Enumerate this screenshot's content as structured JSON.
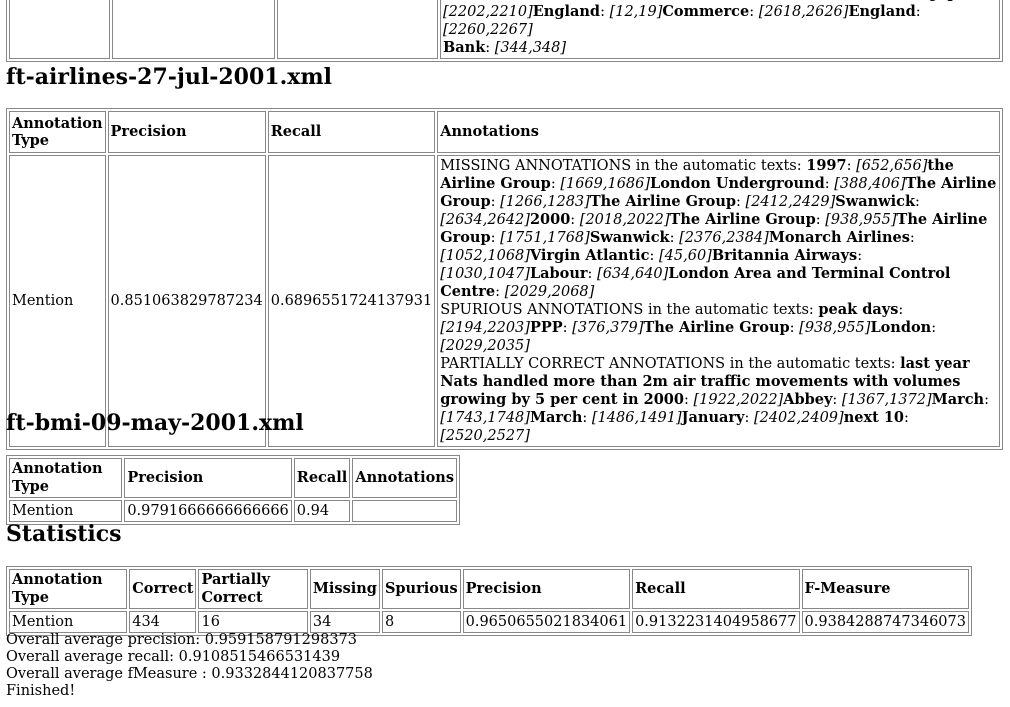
{
  "top_fragment": {
    "line1": [
      {
        "t": "plain",
        "v": "PARTIALLY CORRECT ANNOTATIONS in the automatic texts: "
      },
      {
        "t": "b",
        "v": "US Japan"
      },
      {
        "t": "plain",
        "v": ": "
      }
    ],
    "line2": [
      {
        "t": "i",
        "v": "[2202,2210]"
      },
      {
        "t": "b",
        "v": "England"
      },
      {
        "t": "plain",
        "v": ": "
      },
      {
        "t": "i",
        "v": "[12,19]"
      },
      {
        "t": "b",
        "v": "Commerce"
      },
      {
        "t": "plain",
        "v": ": "
      },
      {
        "t": "i",
        "v": "[2618,2626]"
      },
      {
        "t": "b",
        "v": "England"
      },
      {
        "t": "plain",
        "v": ": "
      },
      {
        "t": "i",
        "v": "[2260,2267]"
      }
    ],
    "line3": [
      {
        "t": "b",
        "v": "Bank"
      },
      {
        "t": "plain",
        "v": ": "
      },
      {
        "t": "i",
        "v": "[344,348]"
      }
    ]
  },
  "section1": {
    "title": "ft-airlines-27-jul-2001.xml",
    "headers": [
      "Annotation Type",
      "Precision",
      "Recall",
      "Annotations"
    ],
    "row": {
      "type": "Mention",
      "precision": "0.851063829787234",
      "recall": "0.6896551724137931",
      "annotations": [
        {
          "t": "plain",
          "v": "MISSING ANNOTATIONS in the automatic texts: "
        },
        {
          "t": "b",
          "v": "1997"
        },
        {
          "t": "plain",
          "v": ": "
        },
        {
          "t": "i",
          "v": "[652,656]"
        },
        {
          "t": "b",
          "v": "the Airline Group"
        },
        {
          "t": "plain",
          "v": ": "
        },
        {
          "t": "i",
          "v": "[1669,1686]"
        },
        {
          "t": "b",
          "v": "London Underground"
        },
        {
          "t": "plain",
          "v": ": "
        },
        {
          "t": "i",
          "v": "[388,406]"
        },
        {
          "t": "b",
          "v": "The Airline Group"
        },
        {
          "t": "plain",
          "v": ": "
        },
        {
          "t": "i",
          "v": "[1266,1283]"
        },
        {
          "t": "b",
          "v": "The Airline Group"
        },
        {
          "t": "plain",
          "v": ": "
        },
        {
          "t": "i",
          "v": "[2412,2429]"
        },
        {
          "t": "b",
          "v": "Swanwick"
        },
        {
          "t": "plain",
          "v": ": "
        },
        {
          "t": "i",
          "v": "[2634,2642]"
        },
        {
          "t": "b",
          "v": "2000"
        },
        {
          "t": "plain",
          "v": ": "
        },
        {
          "t": "i",
          "v": "[2018,2022]"
        },
        {
          "t": "b",
          "v": "The Airline Group"
        },
        {
          "t": "plain",
          "v": ": "
        },
        {
          "t": "i",
          "v": "[938,955]"
        },
        {
          "t": "b",
          "v": "The Airline Group"
        },
        {
          "t": "plain",
          "v": ": "
        },
        {
          "t": "i",
          "v": "[1751,1768]"
        },
        {
          "t": "b",
          "v": "Swanwick"
        },
        {
          "t": "plain",
          "v": ": "
        },
        {
          "t": "i",
          "v": "[2376,2384]"
        },
        {
          "t": "b",
          "v": "Monarch Airlines"
        },
        {
          "t": "plain",
          "v": ": "
        },
        {
          "t": "i",
          "v": "[1052,1068]"
        },
        {
          "t": "b",
          "v": "Virgin Atlantic"
        },
        {
          "t": "plain",
          "v": ": "
        },
        {
          "t": "i",
          "v": "[45,60]"
        },
        {
          "t": "b",
          "v": "Britannia Airways"
        },
        {
          "t": "plain",
          "v": ": "
        },
        {
          "t": "i",
          "v": "[1030,1047]"
        },
        {
          "t": "b",
          "v": "Labour"
        },
        {
          "t": "plain",
          "v": ": "
        },
        {
          "t": "i",
          "v": "[634,640]"
        },
        {
          "t": "b",
          "v": "London Area and Terminal Control Centre"
        },
        {
          "t": "plain",
          "v": ": "
        },
        {
          "t": "i",
          "v": "[2029,2068]"
        },
        {
          "t": "br"
        },
        {
          "t": "plain",
          "v": "SPURIOUS ANNOTATIONS in the automatic texts: "
        },
        {
          "t": "b",
          "v": "peak days"
        },
        {
          "t": "plain",
          "v": ": "
        },
        {
          "t": "i",
          "v": "[2194,2203]"
        },
        {
          "t": "b",
          "v": "PPP"
        },
        {
          "t": "plain",
          "v": ": "
        },
        {
          "t": "i",
          "v": "[376,379]"
        },
        {
          "t": "b",
          "v": "The Airline Group"
        },
        {
          "t": "plain",
          "v": ": "
        },
        {
          "t": "i",
          "v": "[938,955]"
        },
        {
          "t": "b",
          "v": "London"
        },
        {
          "t": "plain",
          "v": ": "
        },
        {
          "t": "i",
          "v": "[2029,2035]"
        },
        {
          "t": "br"
        },
        {
          "t": "plain",
          "v": "PARTIALLY CORRECT ANNOTATIONS in the automatic texts: "
        },
        {
          "t": "b",
          "v": "last year Nats handled more than 2m air traffic movements with volumes growing by 5 per cent in 2000"
        },
        {
          "t": "plain",
          "v": ": "
        },
        {
          "t": "i",
          "v": "[1922,2022]"
        },
        {
          "t": "b",
          "v": "Abbey"
        },
        {
          "t": "plain",
          "v": ": "
        },
        {
          "t": "i",
          "v": "[1367,1372]"
        },
        {
          "t": "b",
          "v": "March"
        },
        {
          "t": "plain",
          "v": ": "
        },
        {
          "t": "i",
          "v": "[1743,1748]"
        },
        {
          "t": "b",
          "v": "March"
        },
        {
          "t": "plain",
          "v": ": "
        },
        {
          "t": "i",
          "v": "[1486,1491]"
        },
        {
          "t": "b",
          "v": "January"
        },
        {
          "t": "plain",
          "v": ": "
        },
        {
          "t": "i",
          "v": "[2402,2409]"
        },
        {
          "t": "b",
          "v": "next 10"
        },
        {
          "t": "plain",
          "v": ": "
        },
        {
          "t": "i",
          "v": "[2520,2527]"
        }
      ]
    }
  },
  "section2": {
    "title": "ft-bmi-09-may-2001.xml",
    "headers": [
      "Annotation Type",
      "Precision",
      "Recall",
      "Annotations"
    ],
    "row": {
      "type": "Mention",
      "precision": "0.9791666666666666",
      "recall": "0.94",
      "annotations": ""
    }
  },
  "statistics": {
    "title": "Statistics",
    "headers": [
      "Annotation Type",
      "Correct",
      "Partially Correct",
      "Missing",
      "Spurious",
      "Precision",
      "Recall",
      "F-Measure"
    ],
    "row": [
      "Mention",
      "434",
      "16",
      "34",
      "8",
      "0.9650655021834061",
      "0.9132231404958677",
      "0.9384288747346073"
    ]
  },
  "summary": {
    "precision": "Overall average precision: 0.959158791298373",
    "recall": "Overall average recall: 0.9108515466531439",
    "fmeasure": "Overall average fMeasure : 0.9332844120837758",
    "finished": "Finished!"
  }
}
